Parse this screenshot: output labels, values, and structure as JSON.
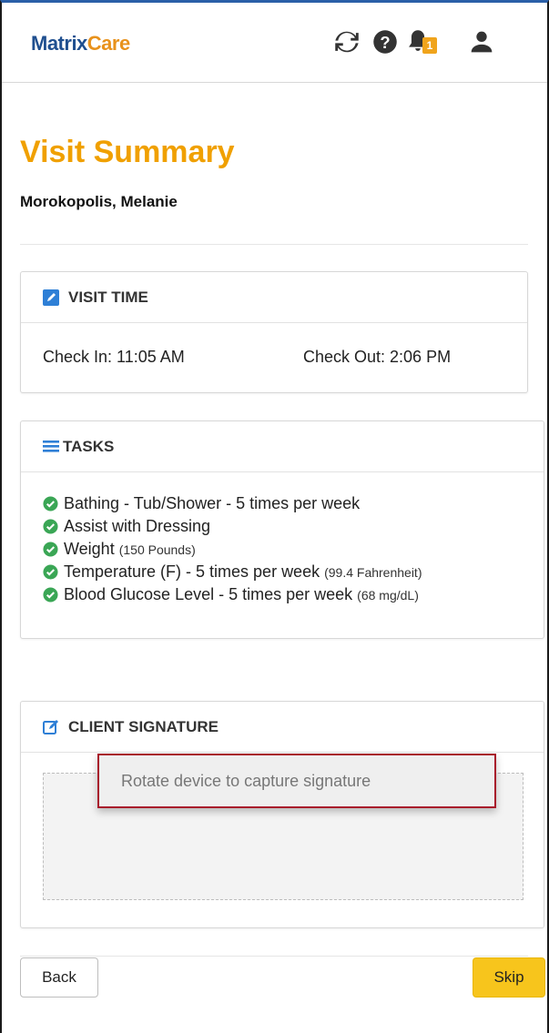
{
  "header": {
    "logo_matrix": "Matrix",
    "logo_care": "Care",
    "notification_count": "1",
    "icons": [
      "refresh-icon",
      "help-icon",
      "bell-icon",
      "user-icon"
    ]
  },
  "page": {
    "title": "Visit Summary",
    "client_name": "Morokopolis, Melanie"
  },
  "visit_time": {
    "heading": "VISIT TIME",
    "check_in": "Check In: 11:05 AM",
    "check_out": "Check Out: 2:06 PM"
  },
  "tasks": {
    "heading": "TASKS",
    "items": [
      {
        "label": "Bathing - Tub/Shower - 5 times per week",
        "detail": ""
      },
      {
        "label": "Assist with Dressing",
        "detail": ""
      },
      {
        "label": "Weight",
        "detail": "(150 Pounds)"
      },
      {
        "label": "Temperature (F) - 5 times per week",
        "detail": "(99.4 Fahrenheit)"
      },
      {
        "label": "Blood Glucose Level - 5 times per week",
        "detail": "(68 mg/dL)"
      }
    ]
  },
  "signature": {
    "heading": "CLIENT SIGNATURE",
    "placeholder": "Rotate device to capture signature"
  },
  "buttons": {
    "back": "Back",
    "skip": "Skip"
  },
  "colors": {
    "title": "#f0a000",
    "brand_blue": "#1f4f8f",
    "brand_orange": "#e8921c",
    "skip_button": "#f7c51c",
    "check": "#3aa655",
    "callout_border": "#a8192b"
  }
}
